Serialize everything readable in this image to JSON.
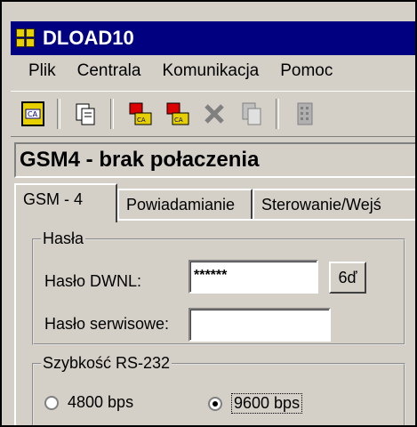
{
  "window": {
    "title": "DLOAD10",
    "accent": "#000080",
    "icon": "app-icon"
  },
  "menu": {
    "items": [
      "Plik",
      "Centrala",
      "Komunikacja",
      "Pomoc"
    ]
  },
  "toolbar": {
    "icons": [
      "central-icon",
      "copy-icon",
      "read-central-icon",
      "write-central-icon",
      "delete-icon",
      "paste-icon",
      "keypad-icon"
    ]
  },
  "status": {
    "text": "GSM4 - brak połaczenia"
  },
  "tabs": [
    {
      "label": "GSM - 4",
      "active": true
    },
    {
      "label": "Powiadamianie",
      "active": false
    },
    {
      "label": "Sterowanie/Wejś",
      "active": false
    }
  ],
  "passwords": {
    "group_label": "Hasła",
    "dwnl_label": "Hasło DWNL:",
    "dwnl_value": "******",
    "dwnl_button": "6ď",
    "service_label": "Hasło serwisowe:",
    "service_value": ""
  },
  "speed": {
    "group_label": "Szybkość RS-232",
    "options": [
      {
        "label": "4800 bps",
        "selected": false
      },
      {
        "label": "9600 bps",
        "selected": true
      }
    ]
  }
}
